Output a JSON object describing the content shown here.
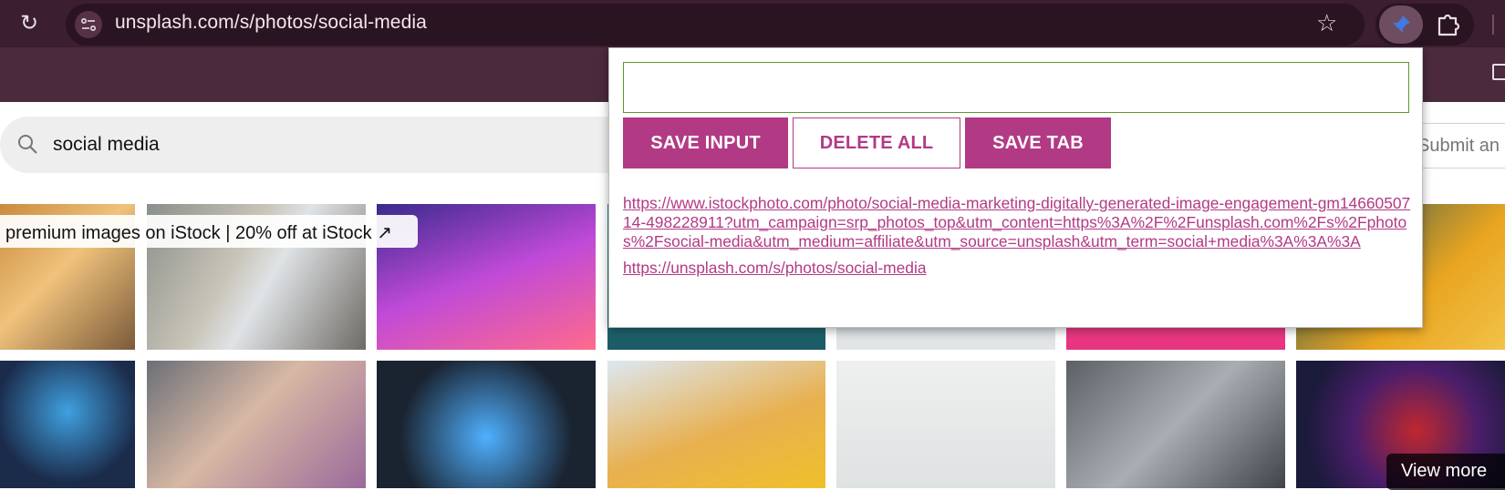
{
  "browser": {
    "url": "unsplash.com/s/photos/social-media",
    "icons": {
      "reload": "reload-icon",
      "site_info": "site-info-icon",
      "bookmark": "star-icon",
      "active_extension": "pin-extension-icon",
      "extensions": "puzzle-icon"
    }
  },
  "page": {
    "search_value": "social media",
    "visual_search_text": "Submit an image",
    "promo_text": "premium images on iStock | 20% off at iStock ↗",
    "view_more_text": "View more"
  },
  "popup": {
    "input_value": "",
    "buttons": {
      "save_input": "SAVE INPUT",
      "delete_all": "DELETE ALL",
      "save_tab": "SAVE TAB"
    },
    "links": [
      "https://www.istockphoto.com/photo/social-media-marketing-digitally-generated-image-engagement-gm1466050714-498228911?utm_campaign=srp_photos_top&utm_content=https%3A%2F%2Funsplash.com%2Fs%2Fphotos%2Fsocial-media&utm_medium=affiliate&utm_source=unsplash&utm_term=social+media%3A%3A%3A",
      "https://unsplash.com/s/photos/social-media"
    ],
    "accent_color": "#b23a85",
    "input_border_color": "#5a9a2e"
  },
  "colors": {
    "toolbar": "#3b1e2f",
    "omnibox": "#2a1421"
  }
}
